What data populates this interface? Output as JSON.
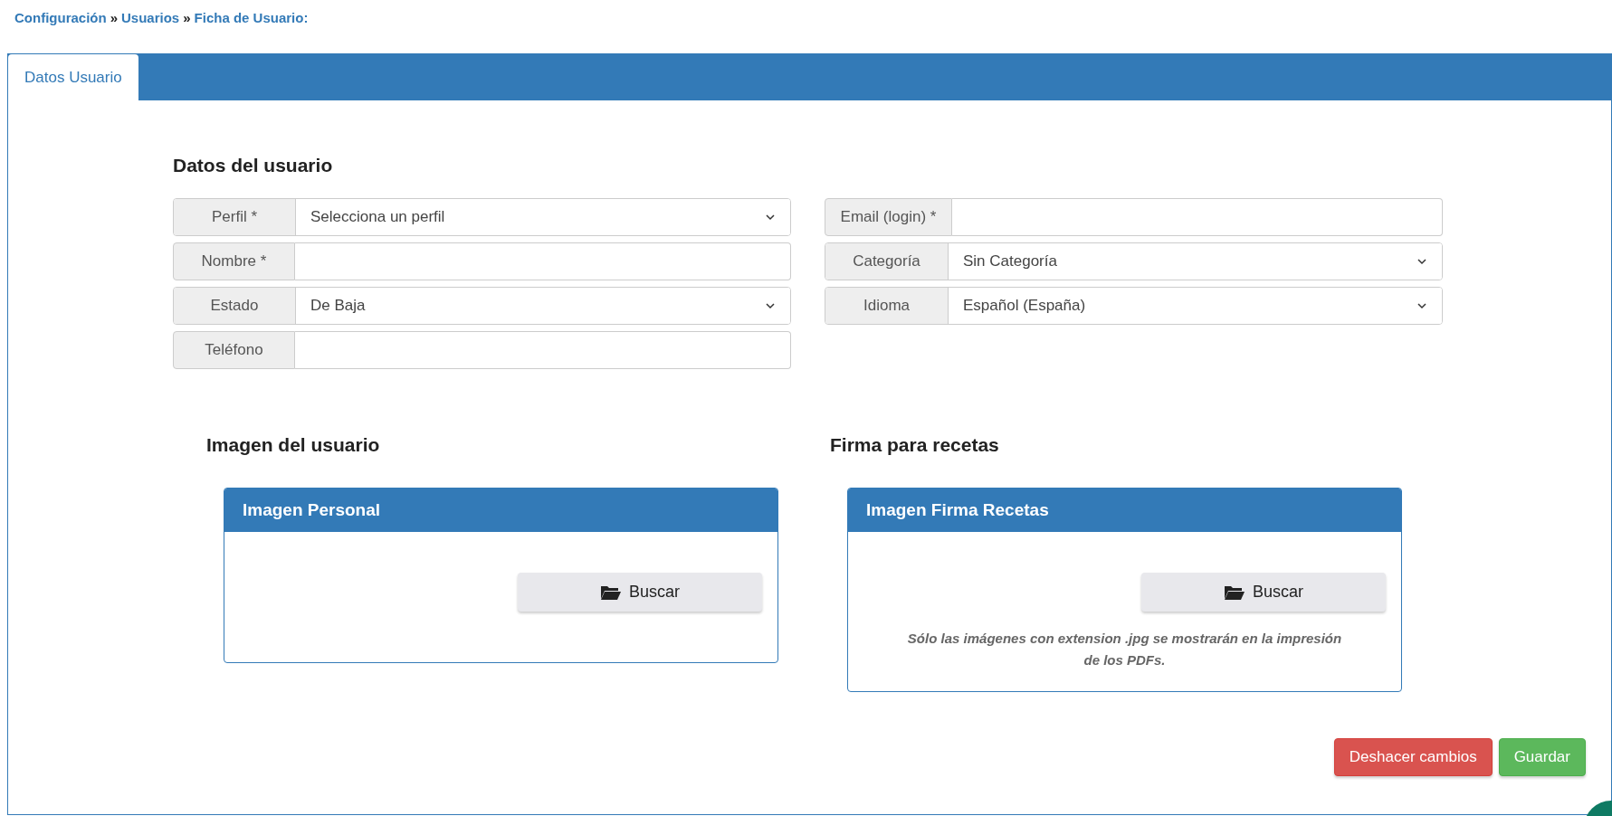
{
  "breadcrumb": [
    {
      "label": "Configuración",
      "kind": "link"
    },
    {
      "label": "»",
      "kind": "separator"
    },
    {
      "label": "Usuarios",
      "kind": "link"
    },
    {
      "label": "»",
      "kind": "separator"
    },
    {
      "label": "Ficha de Usuario:",
      "kind": "link"
    }
  ],
  "tabs": [
    {
      "label": "Datos Usuario",
      "selected": true
    }
  ],
  "user_section": {
    "title": "Datos del usuario",
    "left_fields": [
      {
        "label": "Perfil *",
        "kind": "select",
        "value": "Selecciona un perfil"
      },
      {
        "label": "Nombre *",
        "kind": "input"
      },
      {
        "label": "Estado",
        "kind": "select",
        "value": "De Baja"
      },
      {
        "label": "Teléfono",
        "kind": "input"
      }
    ],
    "right_fields": [
      {
        "label": "Email (login) *",
        "kind": "input"
      },
      {
        "label": "Categoría",
        "kind": "select",
        "value": "Sin Categoría"
      },
      {
        "label": "Idioma",
        "kind": "select",
        "value": "Español (España)"
      }
    ]
  },
  "image_sections": [
    {
      "title": "Imagen del usuario",
      "panel_title": "Imagen Personal",
      "button": "Buscar"
    },
    {
      "title": "Firma para recetas",
      "panel_title": "Imagen Firma Recetas",
      "button": "Buscar",
      "note": "Sólo las imágenes con extension .jpg se mostrarán en la impresión de los PDFs."
    }
  ],
  "actions": [
    {
      "label": "Deshacer cambios",
      "kind": "danger"
    },
    {
      "label": "Guardar",
      "kind": "success"
    }
  ]
}
